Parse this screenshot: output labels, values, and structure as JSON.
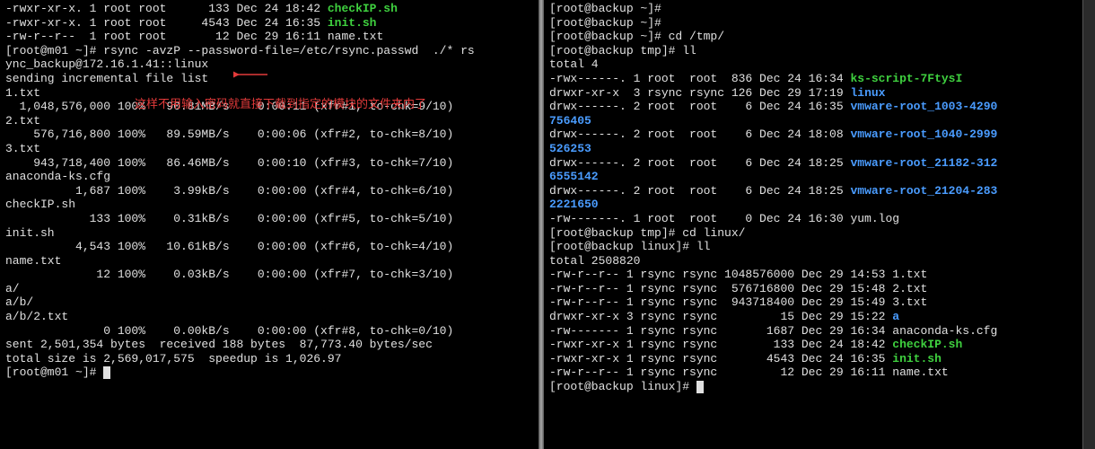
{
  "left": {
    "pre_lines": [
      {
        "segs": [
          {
            "t": "-rwxr-xr-x. 1 root root      133 Dec 24 18:42 "
          },
          {
            "t": "checkIP.sh",
            "c": "green"
          }
        ]
      },
      {
        "segs": [
          {
            "t": "-rwxr-xr-x. 1 root root     4543 Dec 24 16:35 "
          },
          {
            "t": "init.sh",
            "c": "green"
          }
        ]
      },
      {
        "segs": [
          {
            "t": "-rw-r--r--  1 root root       12 Dec 29 16:11 name.txt"
          }
        ]
      }
    ],
    "cmd": {
      "prompt": "[root@m01 ~]# ",
      "command": "rsync -avzP --password-file=/etc/rsync.passwd  ./* rs",
      "wrap": "ync_backup@172.16.1.41::linux"
    },
    "annotation": "这样不用输入密码就直接下载到指定的模块的文件夹内了",
    "rsync_lines": [
      "sending incremental file list",
      "1.txt",
      "  1,048,576,000 100%   90.81MB/s    0:00:11 (xfr#1, to-chk=9/10)",
      "2.txt",
      "    576,716,800 100%   89.59MB/s    0:00:06 (xfr#2, to-chk=8/10)",
      "3.txt",
      "    943,718,400 100%   86.46MB/s    0:00:10 (xfr#3, to-chk=7/10)",
      "anaconda-ks.cfg",
      "          1,687 100%    3.99kB/s    0:00:00 (xfr#4, to-chk=6/10)",
      "checkIP.sh",
      "            133 100%    0.31kB/s    0:00:00 (xfr#5, to-chk=5/10)",
      "init.sh",
      "          4,543 100%   10.61kB/s    0:00:00 (xfr#6, to-chk=4/10)",
      "name.txt",
      "             12 100%    0.03kB/s    0:00:00 (xfr#7, to-chk=3/10)",
      "a/",
      "a/b/",
      "a/b/2.txt",
      "              0 100%    0.00kB/s    0:00:00 (xfr#8, to-chk=0/10)",
      "",
      "sent 2,501,354 bytes  received 188 bytes  87,773.40 bytes/sec",
      "total size is 2,569,017,575  speedup is 1,026.97"
    ],
    "final_prompt": "[root@m01 ~]# "
  },
  "right": {
    "history": [
      {
        "segs": [
          {
            "t": "[root@backup ~]# "
          }
        ]
      },
      {
        "segs": [
          {
            "t": "[root@backup ~]# "
          }
        ]
      },
      {
        "segs": [
          {
            "t": "[root@backup ~]# cd /tmp/"
          }
        ]
      },
      {
        "segs": [
          {
            "t": "[root@backup tmp]# ll"
          }
        ]
      },
      {
        "segs": [
          {
            "t": "total 4"
          }
        ]
      },
      {
        "segs": [
          {
            "t": "-rwx------. 1 root  root  836 Dec 24 16:34 "
          },
          {
            "t": "ks-script-7FtysI",
            "c": "green"
          }
        ]
      },
      {
        "segs": [
          {
            "t": "drwxr-xr-x  3 rsync rsync 126 Dec 29 17:19 "
          },
          {
            "t": "linux",
            "c": "blue"
          }
        ]
      },
      {
        "segs": [
          {
            "t": "drwx------. 2 root  root    6 Dec 24 16:35 "
          },
          {
            "t": "vmware-root_1003-4290",
            "c": "blue"
          }
        ]
      },
      {
        "segs": [
          {
            "t": "756405",
            "c": "blue"
          }
        ]
      },
      {
        "segs": [
          {
            "t": "drwx------. 2 root  root    6 Dec 24 18:08 "
          },
          {
            "t": "vmware-root_1040-2999",
            "c": "blue"
          }
        ]
      },
      {
        "segs": [
          {
            "t": "526253",
            "c": "blue"
          }
        ]
      },
      {
        "segs": [
          {
            "t": "drwx------. 2 root  root    6 Dec 24 18:25 "
          },
          {
            "t": "vmware-root_21182-312",
            "c": "blue"
          }
        ]
      },
      {
        "segs": [
          {
            "t": "6555142",
            "c": "blue"
          }
        ]
      },
      {
        "segs": [
          {
            "t": "drwx------. 2 root  root    6 Dec 24 18:25 "
          },
          {
            "t": "vmware-root_21204-283",
            "c": "blue"
          }
        ]
      },
      {
        "segs": [
          {
            "t": "2221650",
            "c": "blue"
          }
        ]
      },
      {
        "segs": [
          {
            "t": "-rw-------. 1 root  root    0 Dec 24 16:30 yum.log"
          }
        ]
      },
      {
        "segs": [
          {
            "t": "[root@backup tmp]# cd linux/"
          }
        ]
      },
      {
        "segs": [
          {
            "t": "[root@backup linux]# ll"
          }
        ]
      },
      {
        "segs": [
          {
            "t": "total 2508820"
          }
        ]
      },
      {
        "segs": [
          {
            "t": "-rw-r--r-- 1 rsync rsync 1048576000 Dec 29 14:53 1.txt"
          }
        ]
      },
      {
        "segs": [
          {
            "t": "-rw-r--r-- 1 rsync rsync  576716800 Dec 29 15:48 2.txt"
          }
        ]
      },
      {
        "segs": [
          {
            "t": "-rw-r--r-- 1 rsync rsync  943718400 Dec 29 15:49 3.txt"
          }
        ]
      },
      {
        "segs": [
          {
            "t": "drwxr-xr-x 3 rsync rsync         15 Dec 29 15:22 "
          },
          {
            "t": "a",
            "c": "blue"
          }
        ]
      },
      {
        "segs": [
          {
            "t": "-rw------- 1 rsync rsync       1687 Dec 29 16:34 anaconda-ks.cfg"
          }
        ]
      },
      {
        "segs": [
          {
            "t": "-rwxr-xr-x 1 rsync rsync        133 Dec 24 18:42 "
          },
          {
            "t": "checkIP.sh",
            "c": "green"
          }
        ]
      },
      {
        "segs": [
          {
            "t": "-rwxr-xr-x 1 rsync rsync       4543 Dec 24 16:35 "
          },
          {
            "t": "init.sh",
            "c": "green"
          }
        ]
      },
      {
        "segs": [
          {
            "t": "-rw-r--r-- 1 rsync rsync         12 Dec 29 16:11 name.txt"
          }
        ]
      }
    ],
    "final_prompt": "[root@backup linux]# "
  }
}
